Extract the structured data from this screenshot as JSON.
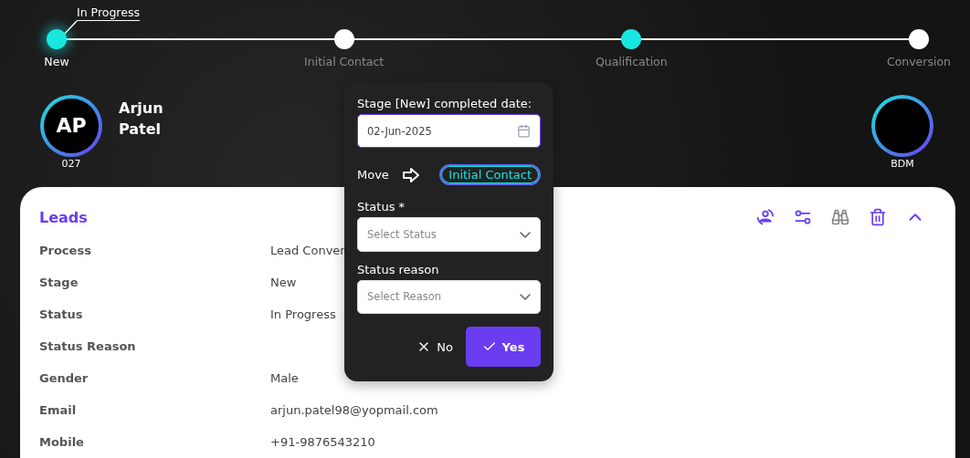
{
  "progress": {
    "callout": "In Progress",
    "stages": [
      {
        "label": "New",
        "selected": true,
        "color": "#19e6e0"
      },
      {
        "label": "Initial Contact",
        "selected": false,
        "color": "#ffffff"
      },
      {
        "label": "Qualification",
        "selected": false,
        "color": "#19e6e0"
      },
      {
        "label": "Conversion",
        "selected": false,
        "color": "#ffffff"
      }
    ]
  },
  "profile": {
    "initials": "AP",
    "name": "Arjun Patel",
    "code": "027",
    "owner_role": "BDM"
  },
  "card": {
    "title": "Leads",
    "fields": [
      {
        "label": "Process",
        "value": "Lead Conver"
      },
      {
        "label": "Stage",
        "value": "New"
      },
      {
        "label": "Status",
        "value": "In Progress"
      },
      {
        "label": "Status Reason"
      },
      {
        "label": "Gender",
        "value": "Male"
      },
      {
        "label": "Email",
        "value": "arjun.patel98@yopmail.com"
      },
      {
        "label": "Mobile",
        "value": "+91-9876543210"
      }
    ]
  },
  "popup": {
    "date_label": "Stage [New] completed date:",
    "date_value": "02-Jun-2025",
    "move_label": "Move",
    "move_target": "Initial Contact",
    "status_label": "Status *",
    "status_placeholder": "Select Status",
    "reason_label": "Status reason",
    "reason_placeholder": "Select Reason",
    "no": "No",
    "yes": "Yes"
  }
}
